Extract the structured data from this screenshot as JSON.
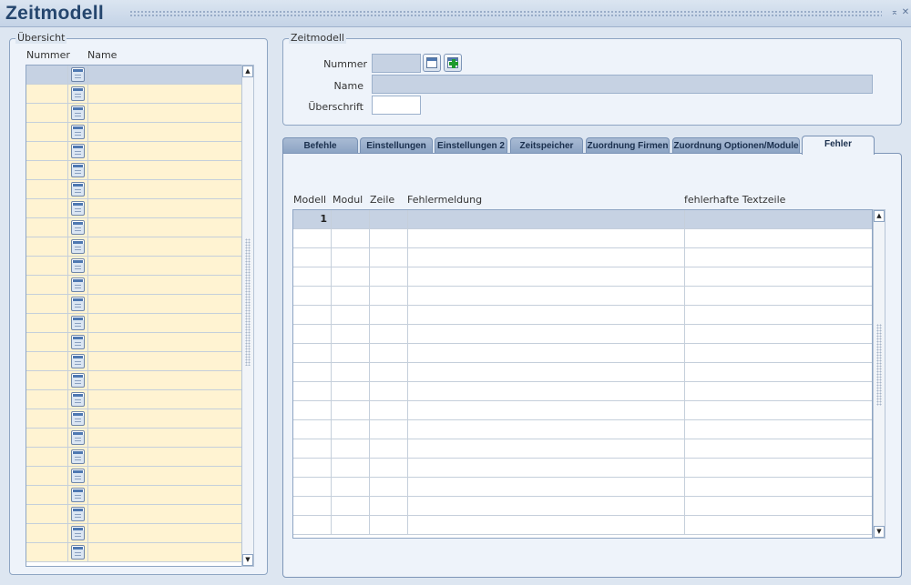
{
  "window": {
    "title": "Zeitmodell",
    "minimize_glyph": "⌅",
    "close_glyph": "✕"
  },
  "overview": {
    "legend": "Übersicht",
    "col_number": "Nummer",
    "col_name": "Name",
    "row_count": 26
  },
  "zeitmodell": {
    "legend": "Zeitmodell",
    "nummer_label": "Nummer",
    "nummer_value": "",
    "name_label": "Name",
    "name_value": "",
    "ueberschrift_label": "Überschrift",
    "ueberschrift_value": ""
  },
  "tabs": [
    {
      "label": "Befehle"
    },
    {
      "label": "Einstellungen"
    },
    {
      "label": "Einstellungen 2"
    },
    {
      "label": "Zeitspeicher"
    },
    {
      "label": "Zuordnung Firmen"
    },
    {
      "label": "Zuordnung Optionen/Module"
    },
    {
      "label": "Fehler"
    }
  ],
  "active_tab": "Fehler",
  "fehler": {
    "col_modell": "Modell",
    "col_modul": "Modul",
    "col_zeile": "Zeile",
    "col_fehlermeldung": "Fehlermeldung",
    "col_textzeile": "fehlerhafte Textzeile",
    "first_row_modell": "1",
    "row_count": 17
  },
  "scroll": {
    "up_glyph": "▲",
    "down_glyph": "▼"
  },
  "colors": {
    "accent": "#25466e",
    "row_highlight": "#fff3d2",
    "selected": "#c6d2e3"
  }
}
